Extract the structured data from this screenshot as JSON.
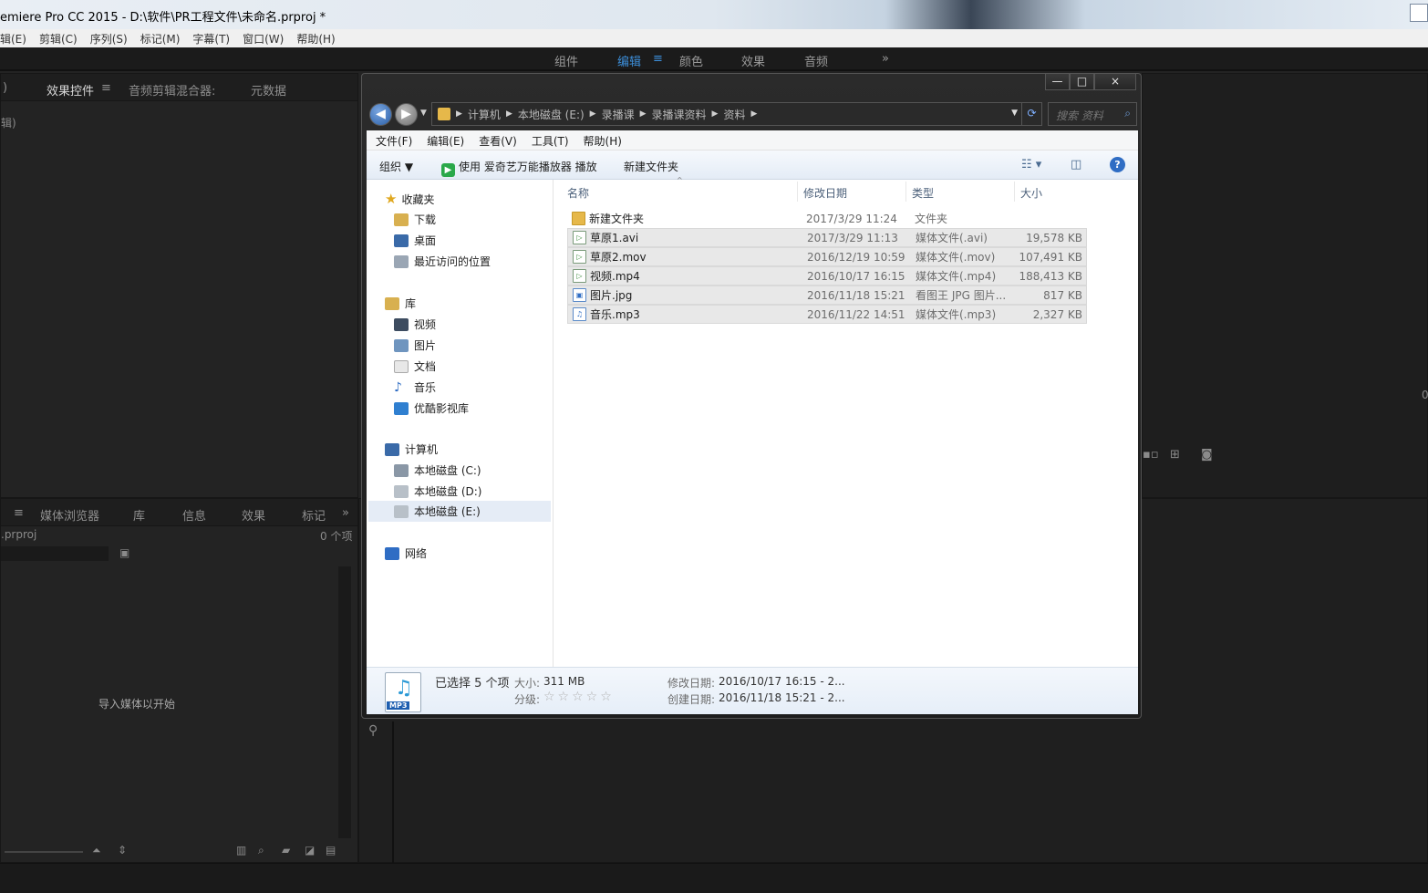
{
  "premiere": {
    "title": "emiere Pro CC 2015 - D:\\软件\\PR工程文件\\未命名.prproj *",
    "menu": [
      "辑(E)",
      "剪辑(C)",
      "序列(S)",
      "标记(M)",
      "字幕(T)",
      "窗口(W)",
      "帮助(H)"
    ],
    "workspace_tabs": [
      "组件",
      "编辑",
      "颜色",
      "效果",
      "音频"
    ],
    "workspace_active": "编辑",
    "workspace_more": "»",
    "top_left_panel": {
      "tabs": [
        ")",
        "效果控件",
        "音频剪辑混合器:",
        "元数据"
      ],
      "sub_label": "辑)"
    },
    "project_panel": {
      "tabs": [
        "≡",
        "媒体浏览器",
        "库",
        "信息",
        "效果",
        "标记"
      ],
      "more": "»",
      "file": ".prproj",
      "count": "0 个项",
      "empty_hint": "导入媒体以开始"
    },
    "monitor_edge_value": "0"
  },
  "explorer": {
    "window_controls": {
      "min": "—",
      "max": "□",
      "close": "×"
    },
    "breadcrumb": [
      "计算机",
      "本地磁盘 (E:)",
      "录播课",
      "录播课资料",
      "资料"
    ],
    "search_placeholder": "搜索 资料",
    "menu": [
      "文件(F)",
      "编辑(E)",
      "查看(V)",
      "工具(T)",
      "帮助(H)"
    ],
    "commands": {
      "organize": "组织 ▼",
      "play_with": "使用 爱奇艺万能播放器 播放",
      "new_folder": "新建文件夹"
    },
    "nav_pane": {
      "favorites": {
        "label": "收藏夹",
        "items": [
          "下载",
          "桌面",
          "最近访问的位置"
        ]
      },
      "libraries": {
        "label": "库",
        "items": [
          "视频",
          "图片",
          "文档",
          "音乐",
          "优酷影视库"
        ]
      },
      "computer": {
        "label": "计算机",
        "items": [
          "本地磁盘 (C:)",
          "本地磁盘 (D:)",
          "本地磁盘 (E:)"
        ]
      },
      "network": {
        "label": "网络"
      }
    },
    "columns": [
      "名称",
      "修改日期",
      "类型",
      "大小"
    ],
    "files": [
      {
        "name": "新建文件夹",
        "date": "2017/3/29 11:24",
        "type": "文件夹",
        "size": "",
        "icon": "folder-icon",
        "selected": false
      },
      {
        "name": "草原1.avi",
        "date": "2017/3/29 11:13",
        "type": "媒体文件(.avi)",
        "size": "19,578 KB",
        "icon": "video-file-icon",
        "selected": true
      },
      {
        "name": "草原2.mov",
        "date": "2016/12/19 10:59",
        "type": "媒体文件(.mov)",
        "size": "107,491 KB",
        "icon": "video-file-icon",
        "selected": true
      },
      {
        "name": "视频.mp4",
        "date": "2016/10/17 16:15",
        "type": "媒体文件(.mp4)",
        "size": "188,413 KB",
        "icon": "video-file-icon",
        "selected": true
      },
      {
        "name": "图片.jpg",
        "date": "2016/11/18 15:21",
        "type": "看图王 JPG 图片...",
        "size": "817 KB",
        "icon": "image-file-icon",
        "selected": true
      },
      {
        "name": "音乐.mp3",
        "date": "2016/11/22 14:51",
        "type": "媒体文件(.mp3)",
        "size": "2,327 KB",
        "icon": "music-file-icon",
        "selected": true
      }
    ],
    "details": {
      "selected": "已选择 5 个项",
      "size_label": "大小:",
      "size_value": "311 MB",
      "rating_label": "分级:",
      "rating_stars": "☆☆☆☆☆",
      "modified_label": "修改日期:",
      "modified_value": "2016/10/17 16:15 - 2...",
      "created_label": "创建日期:",
      "created_value": "2016/11/18 15:21 - 2...",
      "icon_tag": "MP3"
    }
  },
  "colors": {
    "premiere_bg": "#232323",
    "premiere_accent": "#3c8ed9",
    "explorer_selection": "#e8e8e8"
  }
}
